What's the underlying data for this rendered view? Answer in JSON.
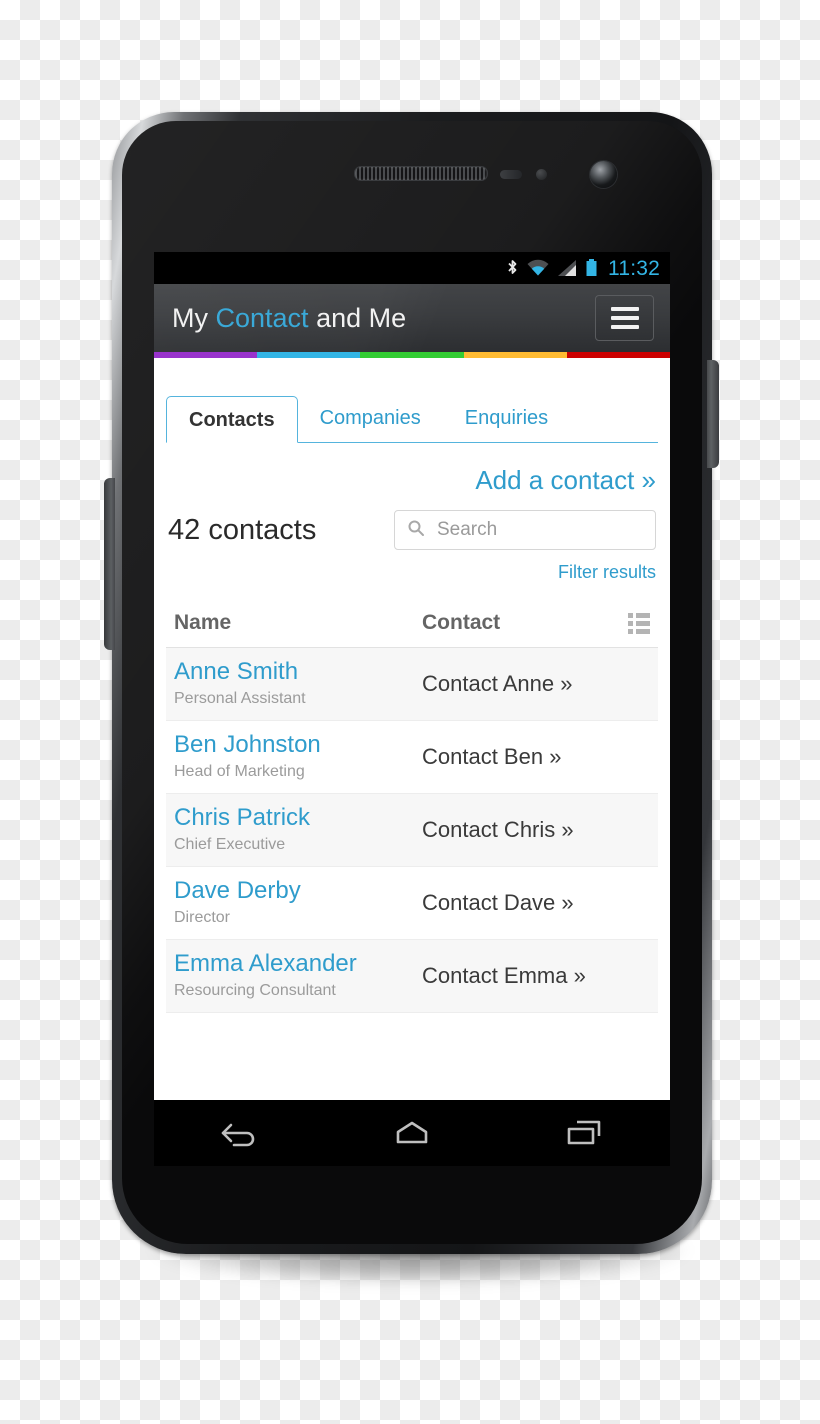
{
  "device": {
    "type": "android-smartphone",
    "hardware": {
      "earpiece": "earpiece-speaker",
      "front_camera": "front-camera",
      "proximity_sensor": "proximity-sensor",
      "light_sensor": "ambient-light-sensor",
      "power_button": "power-button",
      "volume_button": "volume-rocker"
    }
  },
  "status_bar": {
    "time": "11:32",
    "icons": [
      "bluetooth-icon",
      "wifi-icon",
      "cellular-signal-icon",
      "battery-icon"
    ],
    "accent_color": "#33b5e5",
    "background": "#000000"
  },
  "header": {
    "title_prefix": "My ",
    "title_accent": "Contact",
    "title_suffix": " and Me",
    "menu_icon": "hamburger-menu-icon",
    "background": "#3a3c3f"
  },
  "color_stripe": [
    {
      "name": "purple",
      "color": "#9933cc"
    },
    {
      "name": "blue",
      "color": "#33b5e5"
    },
    {
      "name": "green",
      "color": "#33cc33"
    },
    {
      "name": "amber",
      "color": "#ffbb33"
    },
    {
      "name": "red",
      "color": "#cc0000"
    }
  ],
  "tabs": [
    {
      "label": "Contacts",
      "active": true
    },
    {
      "label": "Companies",
      "active": false
    },
    {
      "label": "Enquiries",
      "active": false
    }
  ],
  "toolbar": {
    "add_contact_label": "Add a contact »",
    "contacts_count_label": "42 contacts",
    "filter_results_label": "Filter results",
    "link_color": "#2f9ccc"
  },
  "search": {
    "placeholder": "Search",
    "value": "",
    "icon": "search-icon"
  },
  "table": {
    "headers": {
      "name": "Name",
      "contact": "Contact"
    },
    "view_icon": "list-view-icon",
    "rows": [
      {
        "name": "Anne Smith",
        "role": "Personal Assistant",
        "action": "Contact Anne »"
      },
      {
        "name": "Ben Johnston",
        "role": "Head of Marketing",
        "action": "Contact Ben »"
      },
      {
        "name": "Chris Patrick",
        "role": "Chief Executive",
        "action": "Contact Chris »"
      },
      {
        "name": "Dave Derby",
        "role": "Director",
        "action": "Contact Dave »"
      },
      {
        "name": "Emma Alexander",
        "role": "Resourcing Consultant",
        "action": "Contact Emma »"
      }
    ]
  },
  "nav_bar": {
    "buttons": [
      {
        "name": "back-button",
        "icon": "back-arrow-icon"
      },
      {
        "name": "home-button",
        "icon": "home-icon"
      },
      {
        "name": "recents-button",
        "icon": "recent-apps-icon"
      }
    ],
    "background": "#000000"
  }
}
